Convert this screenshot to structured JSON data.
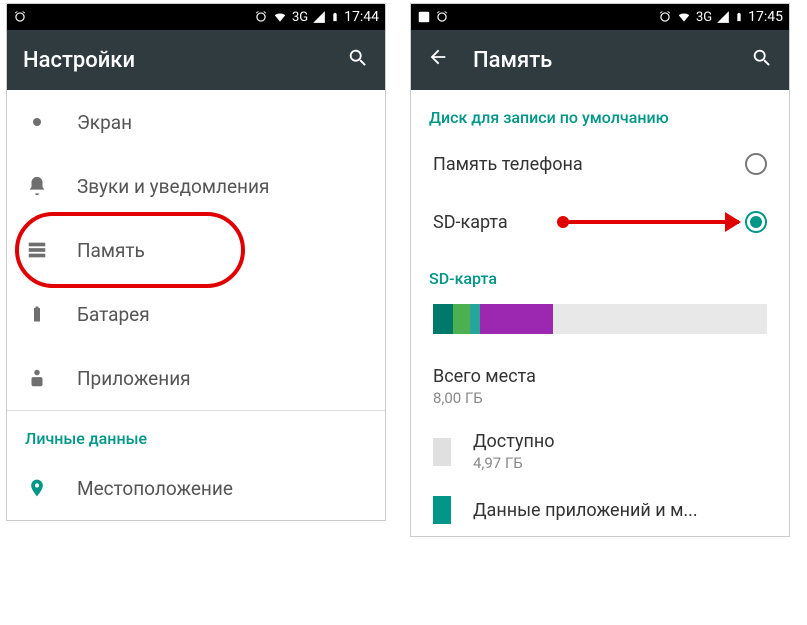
{
  "left": {
    "status": {
      "time": "17:44",
      "network": "3G"
    },
    "appbar": {
      "title": "Настройки"
    },
    "rows": [
      {
        "label": "Экран"
      },
      {
        "label": "Звуки и уведомления"
      },
      {
        "label": "Память"
      },
      {
        "label": "Батарея"
      },
      {
        "label": "Приложения"
      }
    ],
    "section_personal": "Личные данные",
    "rows2": [
      {
        "label": "Местоположение"
      }
    ]
  },
  "right": {
    "status": {
      "time": "17:45",
      "network": "3G"
    },
    "appbar": {
      "title": "Память"
    },
    "section_default": "Диск для записи по умолчанию",
    "options": [
      {
        "label": "Память телефона",
        "selected": false
      },
      {
        "label": "SD-карта",
        "selected": true
      }
    ],
    "section_sd": "SD-карта",
    "total": {
      "label": "Всего места",
      "value": "8,00 ГБ"
    },
    "avail": {
      "label": "Доступно",
      "value": "4,97 ГБ"
    },
    "apps": {
      "label": "Данные приложений и м..."
    }
  }
}
